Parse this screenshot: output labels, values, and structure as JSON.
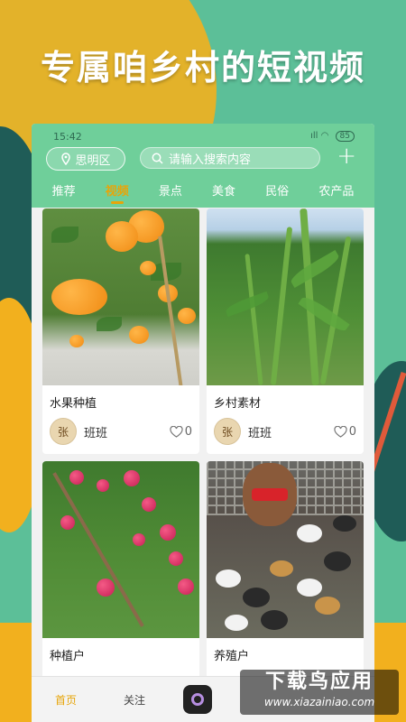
{
  "headline": "专属咱乡村的短视频",
  "status": {
    "time": "15:42",
    "signal": "ıll",
    "wifi": "◠",
    "battery": "85"
  },
  "header": {
    "location": "思明区",
    "search_placeholder": "请输入搜索内容",
    "add": "+"
  },
  "tabs": [
    "推荐",
    "视频",
    "景点",
    "美食",
    "民俗",
    "农产品"
  ],
  "active_tab": "视频",
  "cards": [
    {
      "title": "水果种植",
      "user": "班班",
      "avatar_text": "张",
      "likes": "0"
    },
    {
      "title": "乡村素材",
      "user": "班班",
      "avatar_text": "张",
      "likes": "0"
    },
    {
      "title": "种植户",
      "user": "",
      "avatar_text": "",
      "likes": ""
    },
    {
      "title": "养殖户",
      "user": "",
      "avatar_text": "",
      "likes": ""
    }
  ],
  "bottom_nav": {
    "home": "首页",
    "follow": "关注"
  },
  "watermark": {
    "line1": "下载鸟应用",
    "line2": "www.xiazainiao.com"
  },
  "colors": {
    "header": "#6fcf9a",
    "accent": "#e7a50a",
    "brand_bg": "#5cbf98"
  }
}
